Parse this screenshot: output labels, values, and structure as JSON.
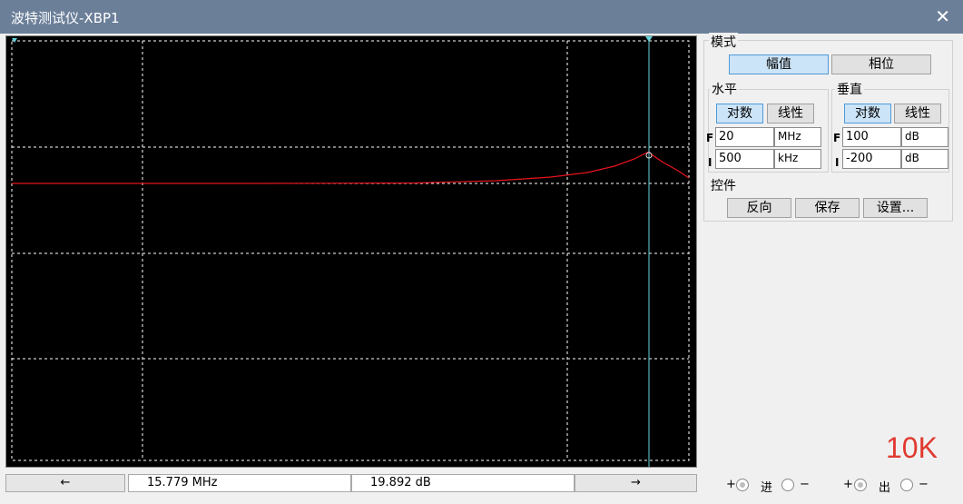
{
  "window": {
    "title": "波特测试仪-XBP1",
    "close_icon": "close-icon"
  },
  "plot": {
    "background": "#000000",
    "grid_color": "#ffffff",
    "curve_color": "#e8141e",
    "cursor_color": "#66d3dc"
  },
  "readout": {
    "left_arrow": "←",
    "frequency": "15.779 MHz",
    "gain": "19.892 dB",
    "right_arrow": "→"
  },
  "mode": {
    "label": "模式",
    "magnitude": "幅值",
    "phase": "相位",
    "selected": "幅值"
  },
  "horizontal": {
    "label": "水平",
    "log": "对数",
    "linear": "线性",
    "selected": "对数",
    "F_label": "F",
    "I_label": "I",
    "F_value": "20",
    "F_unit": "MHz",
    "I_value": "500",
    "I_unit": "kHz"
  },
  "vertical": {
    "label": "垂直",
    "log": "对数",
    "linear": "线性",
    "selected": "对数",
    "F_label": "F",
    "I_label": "I",
    "F_value": "100",
    "F_unit": "dB",
    "I_value": "-200",
    "I_unit": "dB"
  },
  "controls": {
    "label": "控件",
    "reverse": "反向",
    "save": "保存",
    "settings": "设置..."
  },
  "terminals": {
    "in_label": "进",
    "out_label": "出",
    "plus": "+",
    "minus": "−"
  },
  "watermark": "10K"
}
